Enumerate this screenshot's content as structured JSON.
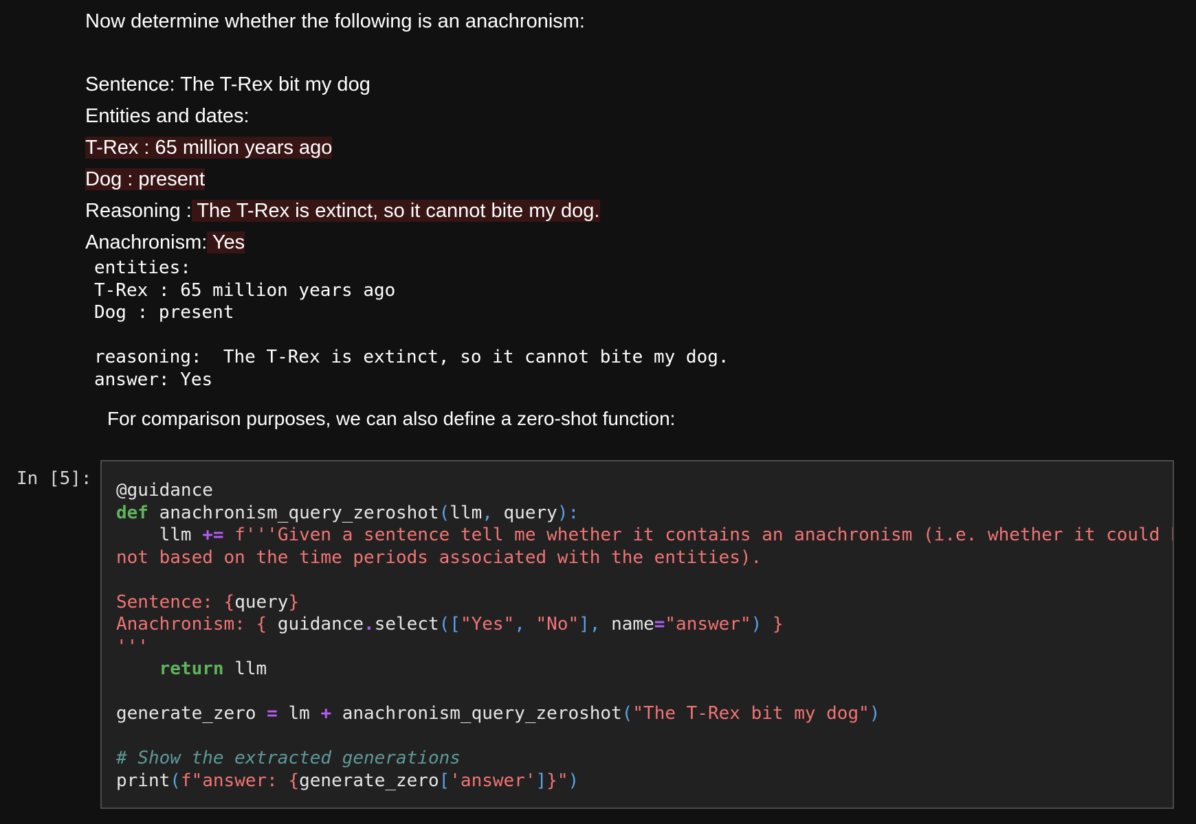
{
  "output": {
    "intro": "Now determine whether the following is an anachronism:",
    "sentence": "Sentence: The T-Rex bit my dog",
    "entities_header": "Entities and dates:",
    "entity1": "T-Rex : 65 million years ago",
    "entity2": "Dog : present",
    "reasoning_label": "Reasoning :",
    "reasoning_value": " The T-Rex is extinct, so it cannot bite my dog.",
    "anachronism_label": "Anachronism:",
    "anachronism_value": " Yes"
  },
  "stdout": {
    "l1": "entities:",
    "l2": "T-Rex : 65 million years ago",
    "l3": "Dog : present",
    "l4": "",
    "l5": "reasoning:  The T-Rex is extinct, so it cannot bite my dog.",
    "l6": "answer: Yes"
  },
  "markdown": {
    "text": "For comparison purposes, we can also define a zero-shot function:"
  },
  "cell": {
    "prompt": "In [5]:",
    "code": {
      "l1_decorator": "@guidance",
      "l2_def": "def",
      "l2_name": " anachronism_query_zeroshot",
      "l2_p1": "(",
      "l2_args1": "llm",
      "l2_comma": ",",
      "l2_args2": " query",
      "l2_p2": "):",
      "l3_indent": "    llm ",
      "l3_op": "+=",
      "l3_str": " f'''Given a sentence tell me whether it contains an anachronism (i.e. whether it could have happened or",
      "l4_str": "not based on the time periods associated with the entities).",
      "l6_str": "Sentence: {",
      "l6_var": "query",
      "l6_close": "}",
      "l7_str": "Anachronism: { ",
      "l7_obj": "guidance",
      "l7_dot": ".",
      "l7_fn": "select",
      "l7_p1": "([",
      "l7_yes": "\"Yes\"",
      "l7_comma": ", ",
      "l7_no": "\"No\"",
      "l7_p2": "],",
      "l7_name": " name",
      "l7_eq": "=",
      "l7_ans": "\"answer\"",
      "l7_p3": ")",
      "l7_close": " }",
      "l8_str": "'''",
      "l9_indent": "    ",
      "l9_kw": "return",
      "l9_var": " llm",
      "l11_var": "generate_zero ",
      "l11_eq": "=",
      "l11_lm": " lm ",
      "l11_plus": "+",
      "l11_fn": " anachronism_query_zeroshot",
      "l11_p1": "(",
      "l11_str": "\"The T-Rex bit my dog\"",
      "l11_p2": ")",
      "l13_comment": "# Show the extracted generations",
      "l14_fn": "print",
      "l14_p1": "(",
      "l14_str1": "f\"answer: {",
      "l14_var": "generate_zero",
      "l14_b1": "[",
      "l14_key": "'answer'",
      "l14_b2": "]",
      "l14_str2": "}\"",
      "l14_p2": ")"
    }
  }
}
